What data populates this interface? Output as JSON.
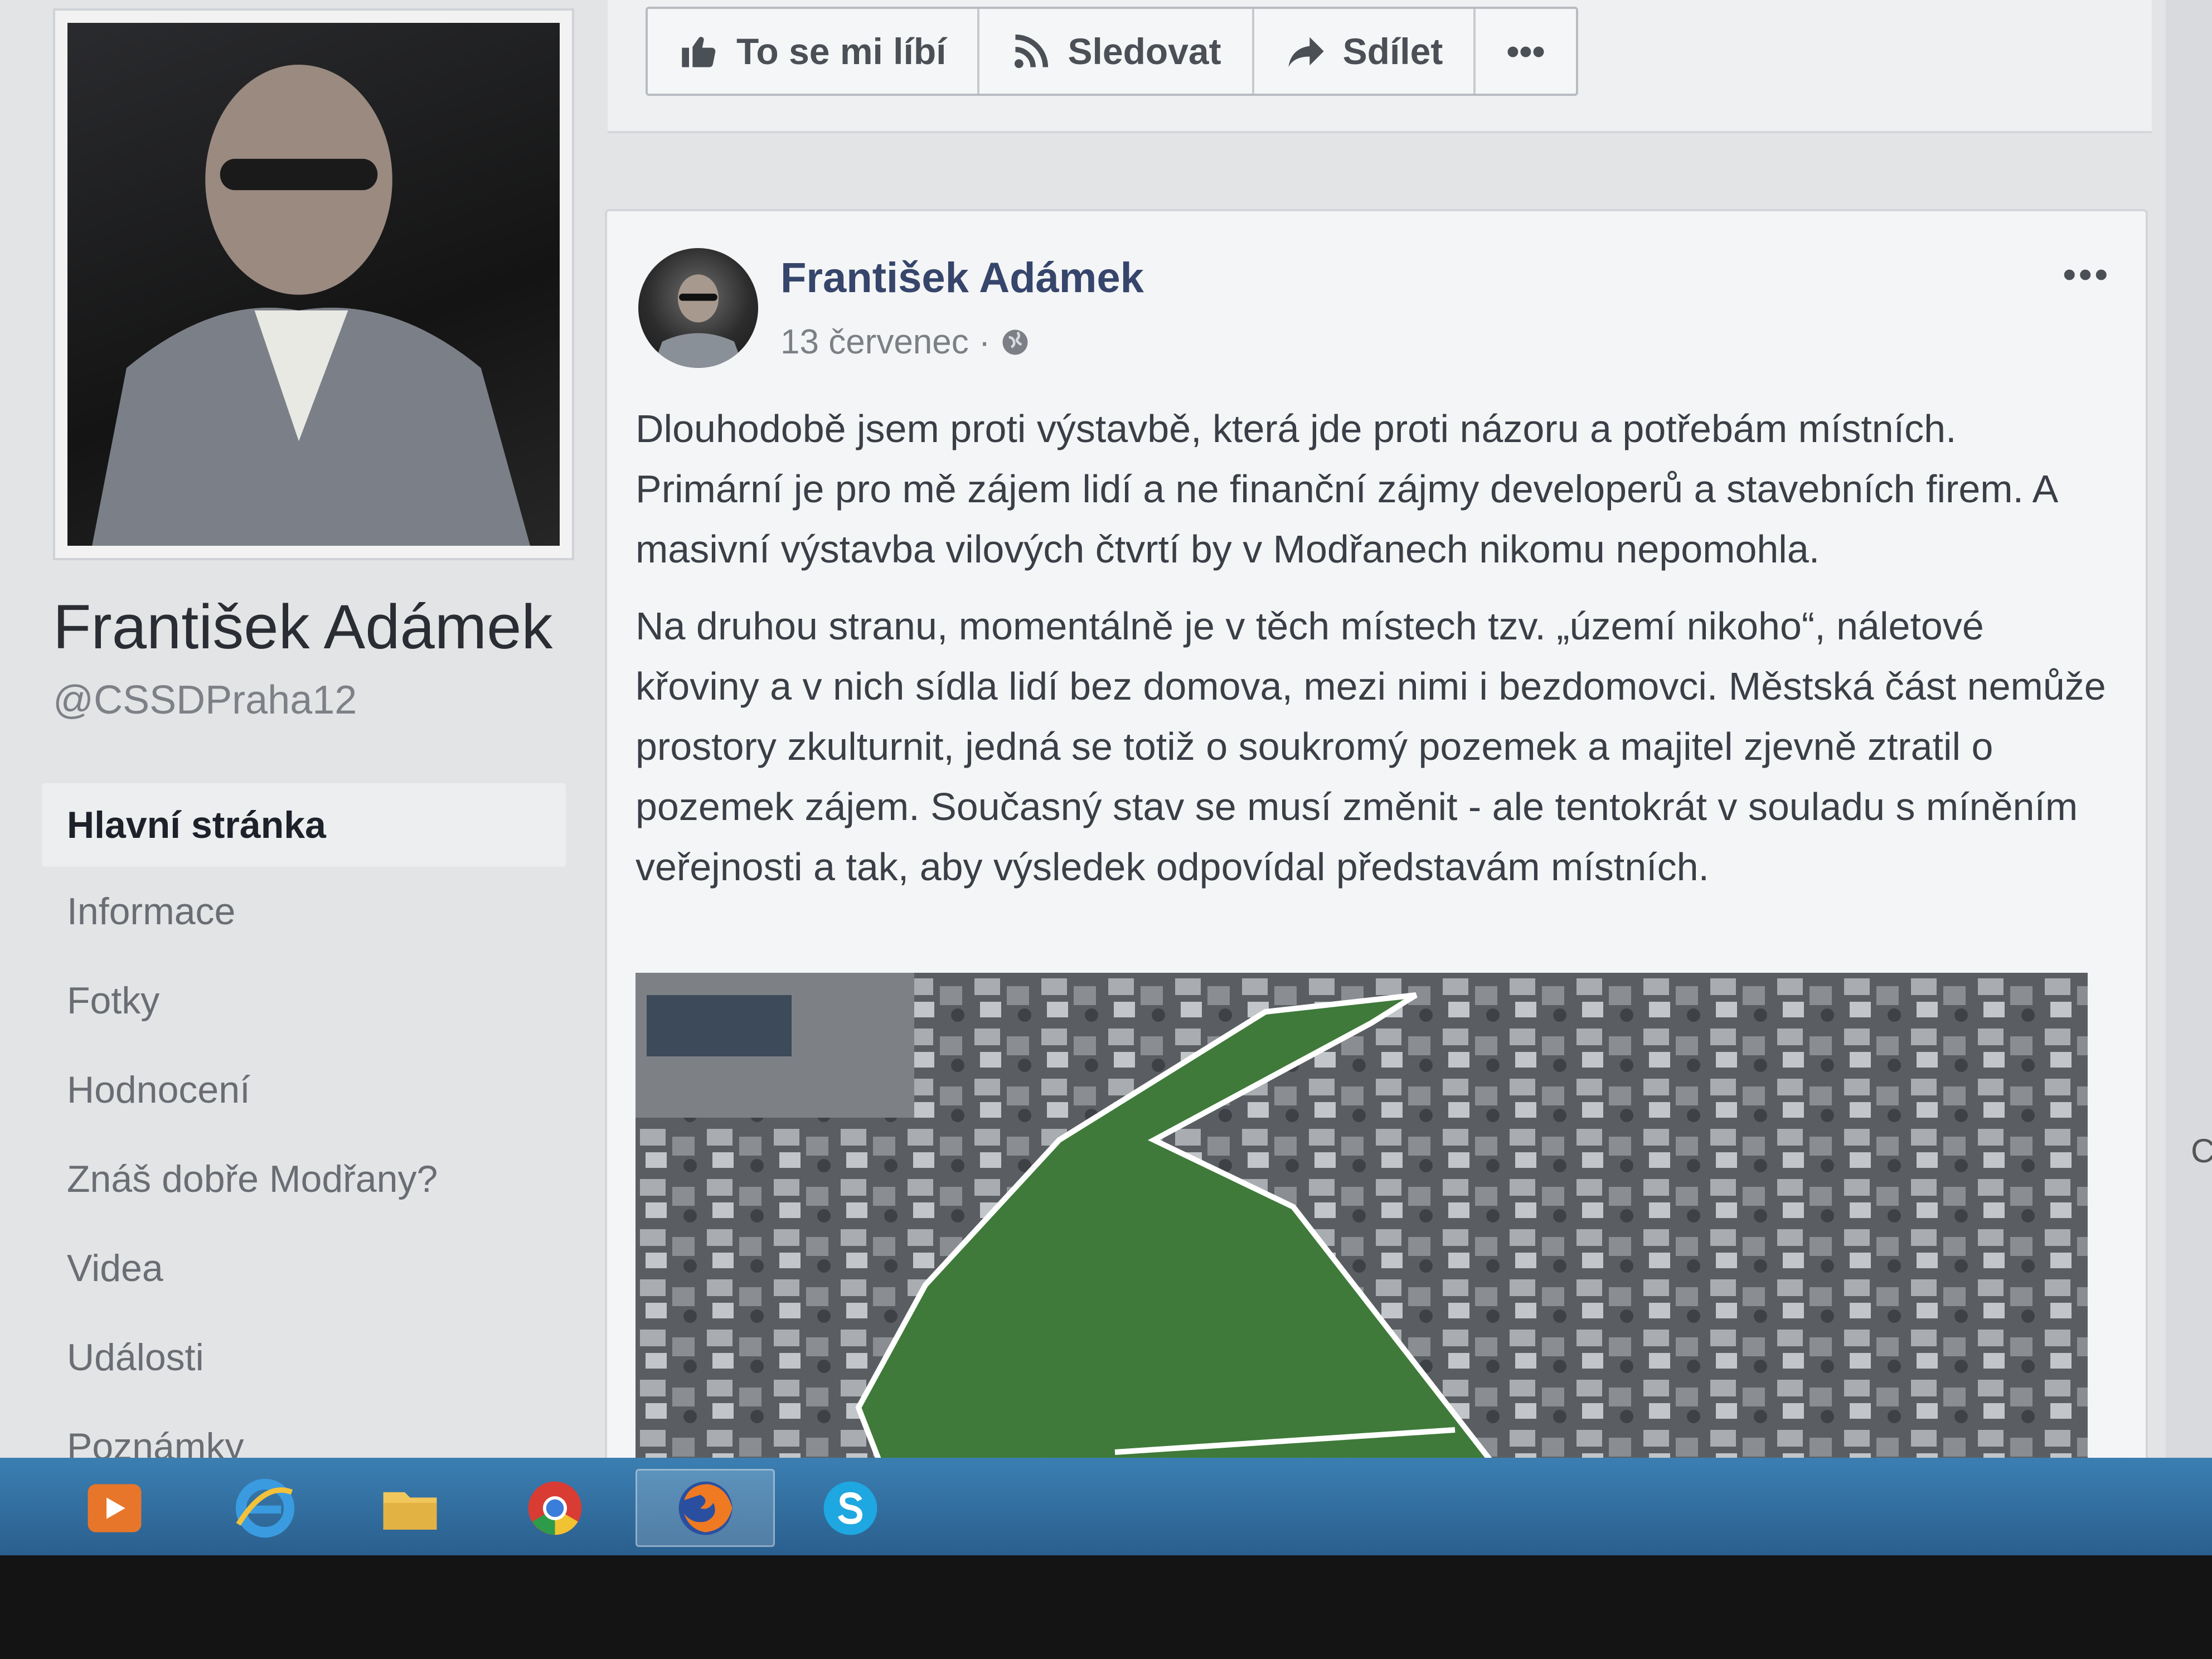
{
  "page": {
    "name": "František Adámek",
    "handle": "@CSSDPraha12",
    "nav": [
      {
        "label": "Hlavní stránka",
        "active": true
      },
      {
        "label": "Informace"
      },
      {
        "label": "Fotky"
      },
      {
        "label": "Hodnocení"
      },
      {
        "label": "Znáš dobře Modřany?"
      },
      {
        "label": "Videa"
      },
      {
        "label": "Události"
      },
      {
        "label": "Poznámky"
      }
    ]
  },
  "actions": {
    "like": "To se mi líbí",
    "follow": "Sledovat",
    "share": "Sdílet",
    "more": "•••"
  },
  "post": {
    "author": "František Adámek",
    "date": "13 červenec",
    "separator": "·",
    "more": "•••",
    "paragraphs": [
      "Dlouhodobě jsem proti výstavbě, která jde proti názoru a potřebám místních. Primární je pro mě zájem lidí a ne finanční zájmy developerů a stavebních firem. A masivní výstavba vilových čtvrtí by v Modřanech nikomu nepomohla.",
      "Na druhou stranu, momentálně je v těch místech tzv. „území nikoho“, náletové křoviny a v nich sídla lidí bez domova, mezi nimi i bezdomovci. Městská část nemůže prostory zkulturnit, jedná se totiž o soukromý pozemek a majitel zjevně ztratil o pozemek zájem. Současný stav se musí změnit - ale tentokrát v souladu s míněním veřejnosti a tak, aby výsledek odpovídal představám místních."
    ]
  },
  "side": {
    "edge_letter": "C"
  },
  "taskbar": {
    "items": [
      "media-player-icon",
      "internet-explorer-icon",
      "file-explorer-icon",
      "chrome-icon",
      "firefox-icon",
      "skype-icon"
    ]
  },
  "colors": {
    "author": "#36456b",
    "highlight_area": "#3f7a3a",
    "taskbar": "#2a5f8e"
  }
}
